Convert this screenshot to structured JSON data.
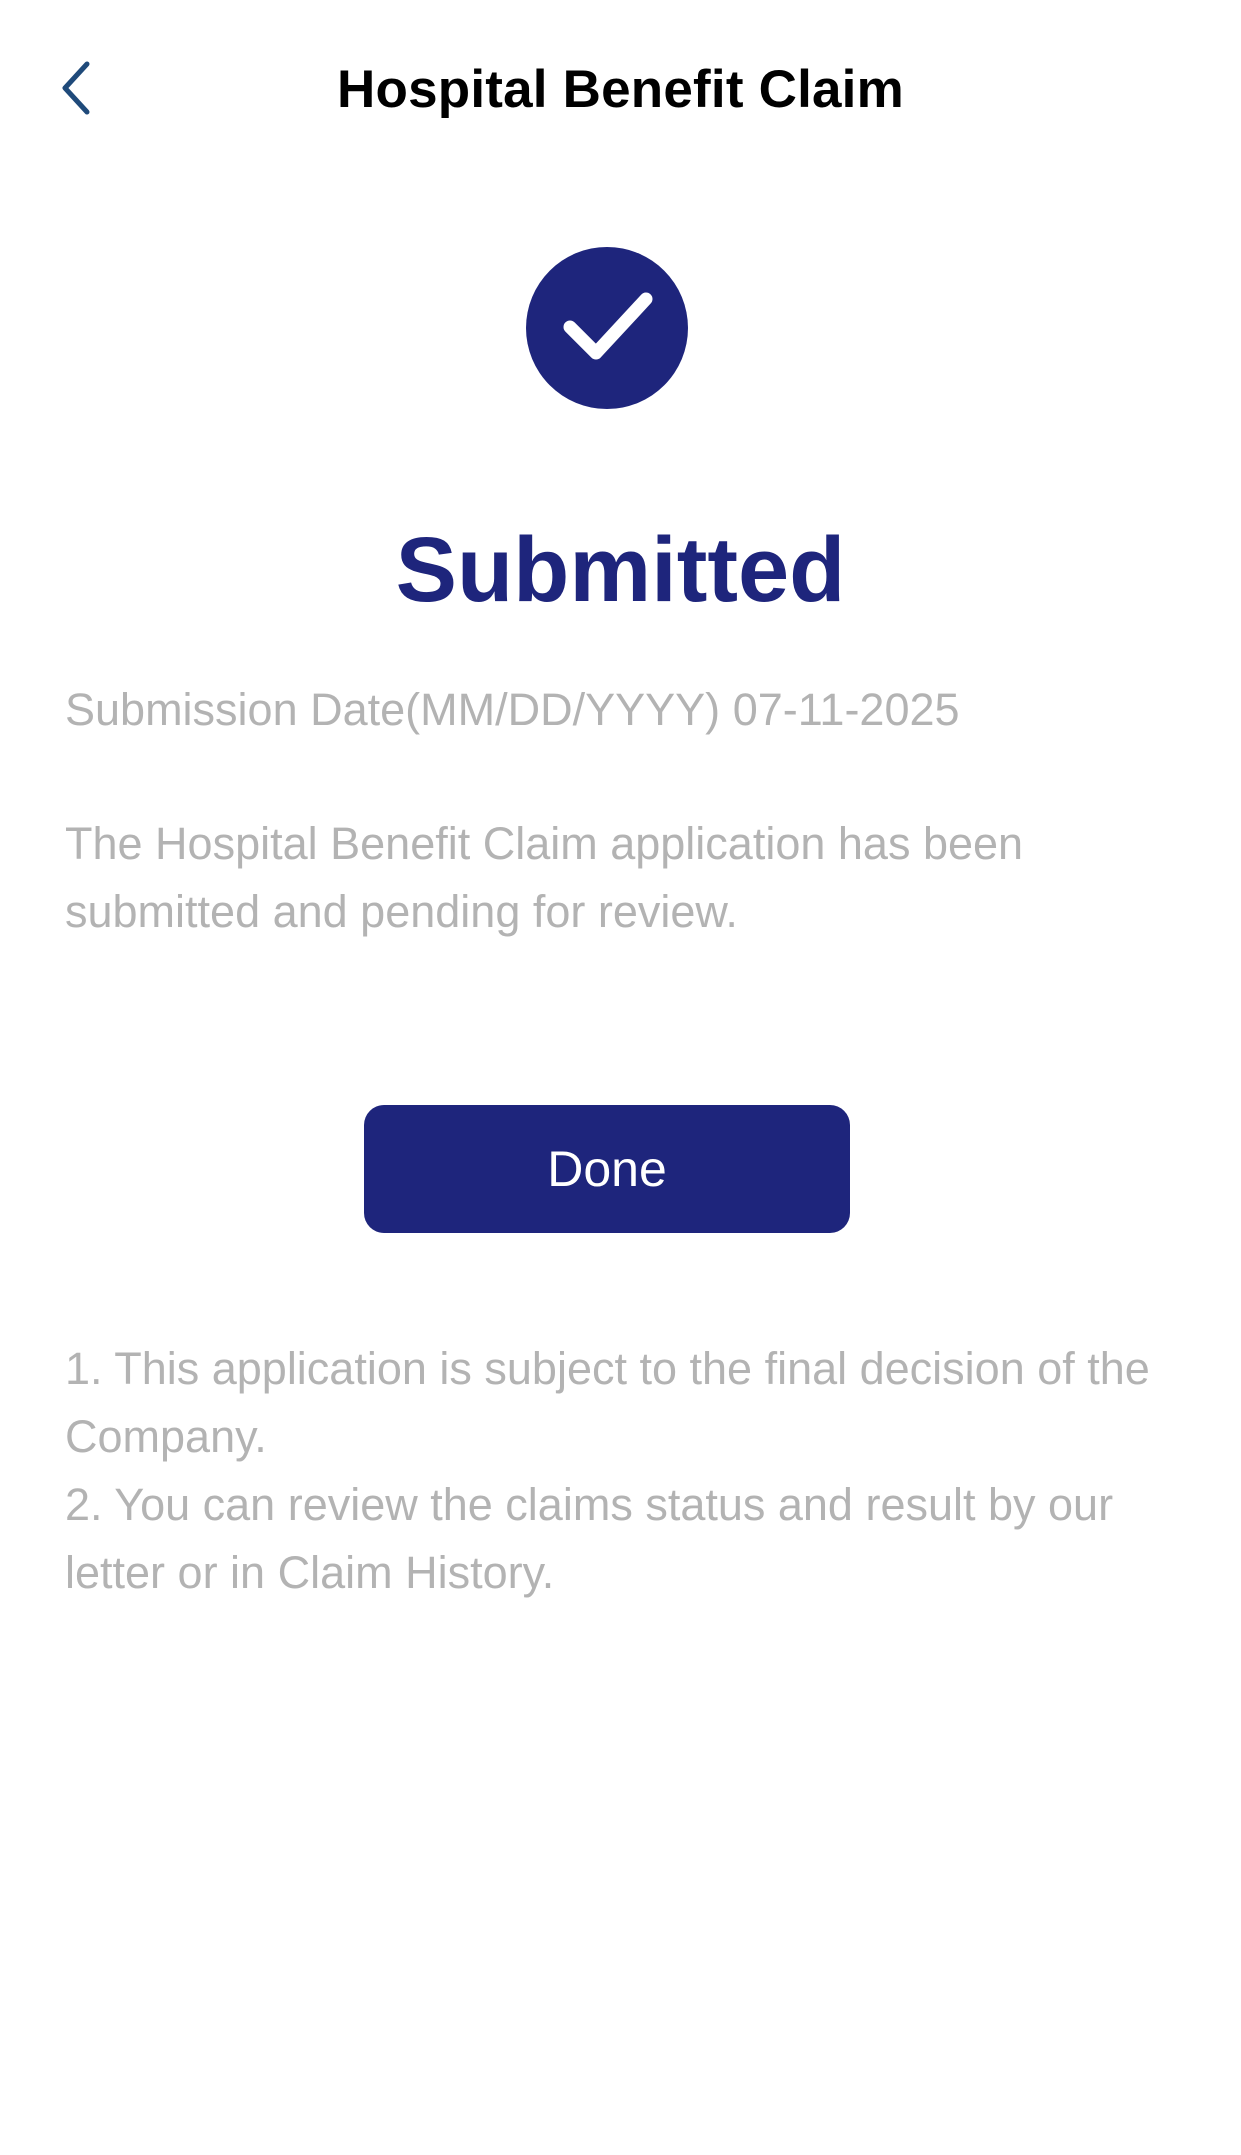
{
  "header": {
    "title": "Hospital Benefit Claim",
    "back_icon": "chevron-left-icon"
  },
  "status": {
    "icon": "check-circle-icon",
    "label": "Submitted"
  },
  "submission": {
    "label": "Submission Date(MM/DD/YYYY)",
    "date": "07-11-2025"
  },
  "message": "The Hospital Benefit Claim application has been submitted and pending for review.",
  "actions": {
    "done_label": "Done"
  },
  "notes": [
    "1. This application is subject to the final decision of the Company.",
    "2. You can review the claims status and result by our letter or in Claim History."
  ],
  "colors": {
    "brand": "#1e257c",
    "muted_text": "#b3b3b3",
    "title_text": "#000000",
    "back_icon": "#1f4a7a"
  }
}
